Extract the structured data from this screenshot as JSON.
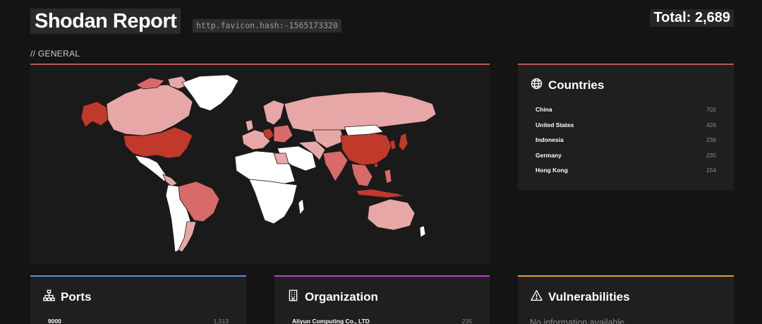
{
  "header": {
    "title": "Shodan Report",
    "query": "http.favicon.hash:-1565173320",
    "total": "Total: 2,689"
  },
  "section": {
    "label": "// GENERAL"
  },
  "countries": {
    "title": "Countries",
    "icon": "globe-icon",
    "items": [
      {
        "name": "China",
        "count": "702"
      },
      {
        "name": "United States",
        "count": "426"
      },
      {
        "name": "Indonesia",
        "count": "236"
      },
      {
        "name": "Germany",
        "count": "235"
      },
      {
        "name": "Hong Kong",
        "count": "154"
      }
    ]
  },
  "ports": {
    "title": "Ports",
    "icon": "network-icon",
    "items": [
      {
        "name": "9000",
        "count": "1,513"
      }
    ]
  },
  "organization": {
    "title": "Organization",
    "icon": "building-icon",
    "items": [
      {
        "name": "Aliyun Computing Co., LTD",
        "count": "235"
      }
    ]
  },
  "vulnerabilities": {
    "title": "Vulnerabilities",
    "icon": "warning-icon",
    "empty_text": "No information available"
  },
  "colors": {
    "background": "#141414",
    "card": "#1f1f1f",
    "accent_general": "#c0564a",
    "accent_ports": "#5b8fcf",
    "accent_org": "#b04bc0",
    "accent_vulns": "#d9a53a",
    "map_high": "#c0392b",
    "map_mid": "#d86a6a",
    "map_low": "#e8a7a7",
    "map_none": "#ffffff"
  }
}
